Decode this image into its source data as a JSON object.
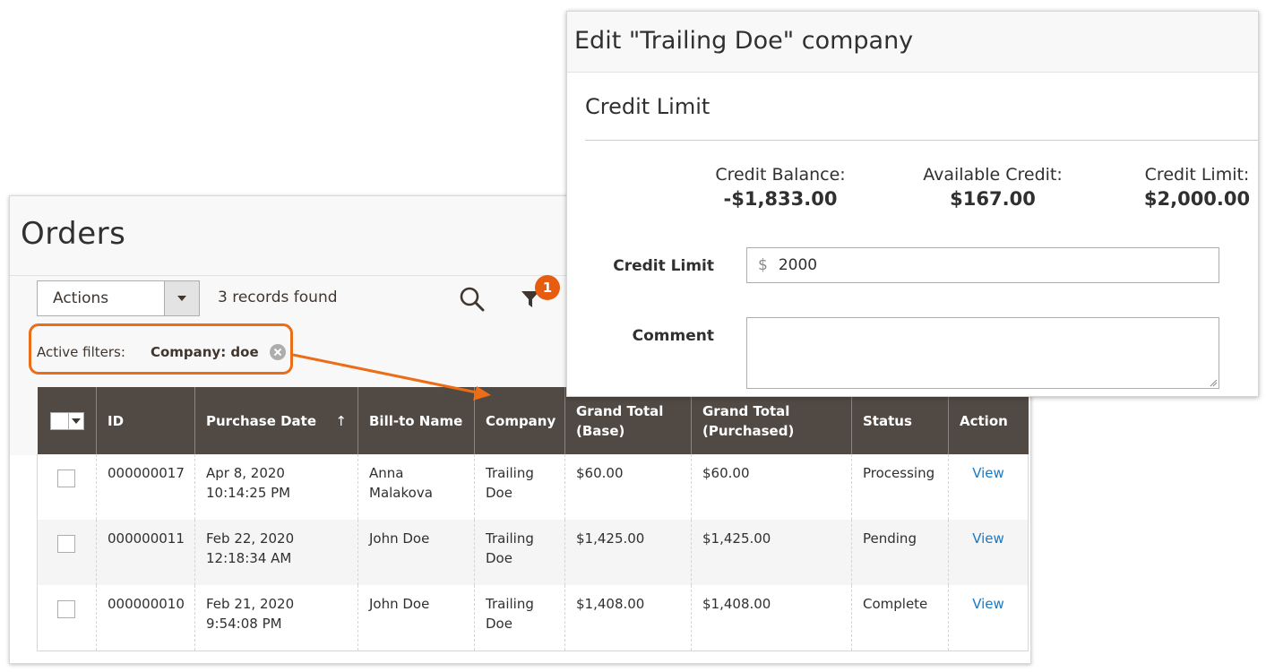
{
  "orders": {
    "title": "Orders",
    "actions_label": "Actions",
    "records_found": "3 records found",
    "filter_count": "1",
    "active_filters_label": "Active filters:",
    "active_filter_chip": "Company: doe",
    "columns": [
      "ID",
      "Purchase Date",
      "Bill-to Name",
      "Company",
      "Grand Total (Base)",
      "Grand Total (Purchased)",
      "Status",
      "Action"
    ],
    "sort_indicator": "↑",
    "rows": [
      {
        "id": "000000017",
        "purchase_date": "Apr 8, 2020 10:14:25 PM",
        "bill_to": "Anna Malakova",
        "company": "Trailing Doe",
        "grand_total_base": "$60.00",
        "grand_total_purchased": "$60.00",
        "status": "Processing",
        "action": "View"
      },
      {
        "id": "000000011",
        "purchase_date": "Feb 22, 2020 12:18:34 AM",
        "bill_to": "John Doe",
        "company": "Trailing Doe",
        "grand_total_base": "$1,425.00",
        "grand_total_purchased": "$1,425.00",
        "status": "Pending",
        "action": "View"
      },
      {
        "id": "000000010",
        "purchase_date": "Feb 21, 2020 9:54:08 PM",
        "bill_to": "John Doe",
        "company": "Trailing Doe",
        "grand_total_base": "$1,408.00",
        "grand_total_purchased": "$1,408.00",
        "status": "Complete",
        "action": "View"
      }
    ]
  },
  "modal": {
    "title": "Edit \"Trailing Doe\" company",
    "section_title": "Credit Limit",
    "summary": [
      {
        "label": "Credit Balance:",
        "value": "-$1,833.00"
      },
      {
        "label": "Available Credit:",
        "value": "$167.00"
      },
      {
        "label": "Credit Limit:",
        "value": "$2,000.00"
      }
    ],
    "credit_limit_label": "Credit Limit",
    "currency_symbol": "$",
    "credit_limit_value": "2000",
    "comment_label": "Comment",
    "comment_value": ""
  },
  "colors": {
    "accent": "#eb6d15",
    "badge": "#e75c0f",
    "table_header": "#514943",
    "link": "#1979c3"
  },
  "icons": {
    "search": "search-icon",
    "filter": "filter-icon",
    "remove_filter": "close-circle-icon",
    "dropdown": "chevron-down-icon"
  }
}
